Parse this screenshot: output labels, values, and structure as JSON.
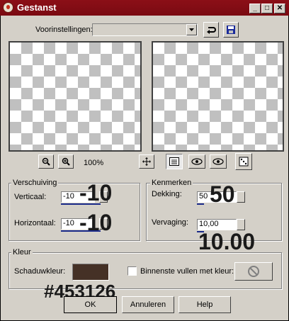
{
  "window": {
    "title": "Gestanst"
  },
  "title_buttons": {
    "minimize": "_",
    "maximize": "□",
    "close": "✕"
  },
  "presets": {
    "label": "Voorinstellingen:",
    "value": ""
  },
  "zoom": {
    "level": "100%"
  },
  "offset": {
    "group_label": "Verschuiving",
    "vertical_label": "Verticaal:",
    "vertical_value": "-10",
    "vertical_overlay": "-10",
    "horizontal_label": "Horizontaal:",
    "horizontal_value": "-10",
    "horizontal_overlay": "-10"
  },
  "attributes": {
    "group_label": "Kenmerken",
    "opacity_label": "Dekking:",
    "opacity_value": "50",
    "opacity_overlay": "50",
    "blur_label": "Vervaging:",
    "blur_value": "10,00",
    "blur_overlay": "10.00"
  },
  "color": {
    "group_label": "Kleur",
    "shadow_label": "Schaduwkleur:",
    "shadow_color": "#453126",
    "shadow_overlay": "#453126",
    "fill_inner_label": "Binnenste vullen met kleur:"
  },
  "buttons": {
    "ok": "OK",
    "cancel": "Annuleren",
    "help": "Help"
  }
}
